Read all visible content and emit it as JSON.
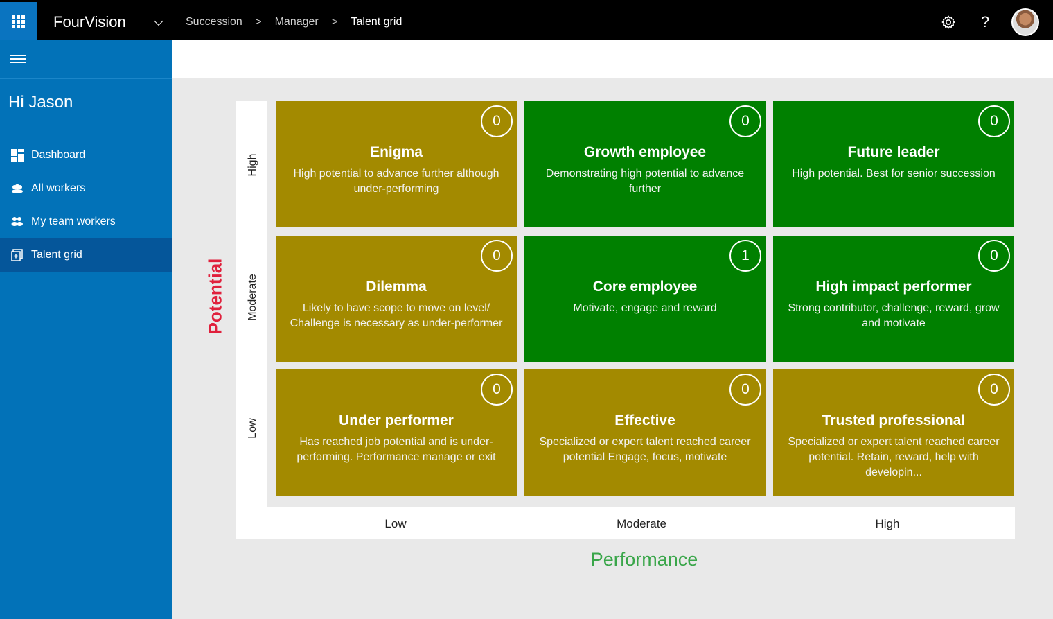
{
  "app": {
    "name": "FourVision"
  },
  "breadcrumb": [
    "Succession",
    "Manager",
    "Talent grid"
  ],
  "header_icons": [
    "gear-icon",
    "help-icon",
    "avatar"
  ],
  "help_glyph": "?",
  "sidebar": {
    "greeting": "Hi Jason",
    "items": [
      {
        "label": "Dashboard",
        "icon": "dashboard-icon"
      },
      {
        "label": "All workers",
        "icon": "workers-icon"
      },
      {
        "label": "My team workers",
        "icon": "team-icon"
      },
      {
        "label": "Talent grid",
        "icon": "talent-grid-icon",
        "active": true
      }
    ]
  },
  "grid": {
    "y_axis_title": "Potential",
    "x_axis_title": "Performance",
    "y_levels": [
      "High",
      "Moderate",
      "Low"
    ],
    "x_levels": [
      "Low",
      "Moderate",
      "High"
    ],
    "colors": {
      "olive": "#a38a00",
      "green": "#008000",
      "potential": "#e0203c",
      "performance": "#3aa64a"
    },
    "cells": [
      {
        "title": "Enigma",
        "desc": "High potential to advance further although under-performing",
        "count": "0",
        "color": "olive"
      },
      {
        "title": "Growth employee",
        "desc": "Demonstrating high potential to advance further",
        "count": "0",
        "color": "green"
      },
      {
        "title": "Future leader",
        "desc": "High potential. Best for senior succession",
        "count": "0",
        "color": "green"
      },
      {
        "title": "Dilemma",
        "desc": "Likely to have scope to move on level/ Challenge is necessary as under-performer",
        "count": "0",
        "color": "olive"
      },
      {
        "title": "Core employee",
        "desc": "Motivate, engage and reward",
        "count": "1",
        "color": "green"
      },
      {
        "title": "High impact performer",
        "desc": "Strong contributor, challenge, reward, grow and motivate",
        "count": "0",
        "color": "green"
      },
      {
        "title": "Under performer",
        "desc": "Has reached job potential and is under-performing. Performance manage or exit",
        "count": "0",
        "color": "olive"
      },
      {
        "title": "Effective",
        "desc": "Specialized or expert talent reached career potential Engage, focus, motivate",
        "count": "0",
        "color": "olive"
      },
      {
        "title": "Trusted professional",
        "desc": "Specialized or expert talent reached career potential. Retain, reward, help with developin...",
        "count": "0",
        "color": "olive"
      }
    ]
  }
}
